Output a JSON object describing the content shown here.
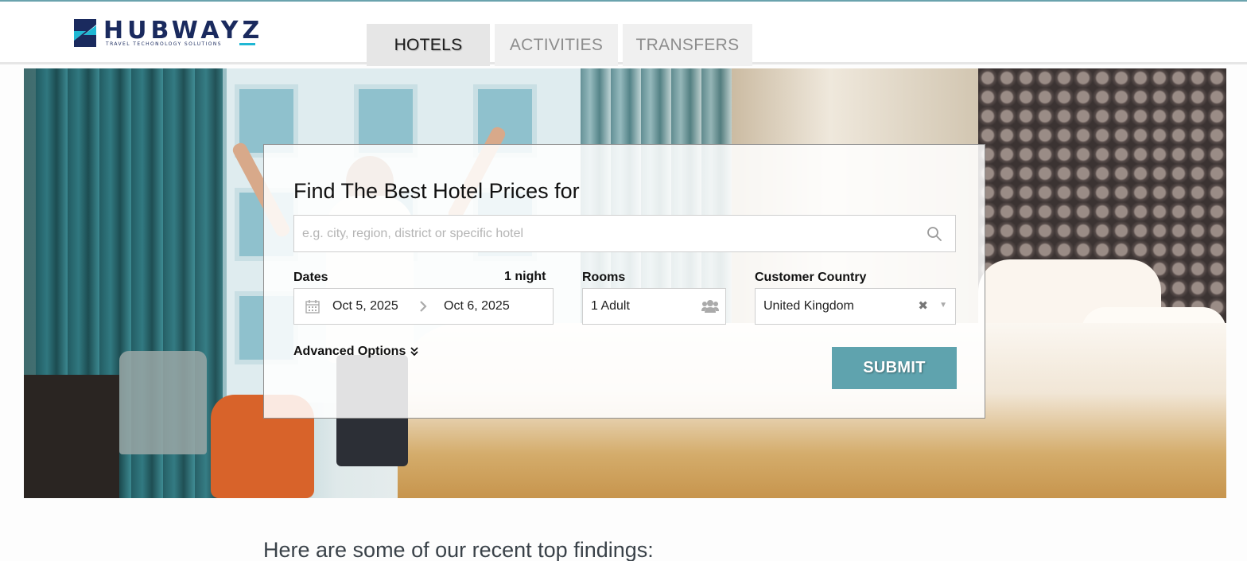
{
  "brand": {
    "name": "HUBWAYZ",
    "tagline": "TRAVEL TECHONOLOGY SOLUTIONS",
    "colors": {
      "navy": "#1a2a5e",
      "cyan": "#1fb7d4"
    }
  },
  "nav": {
    "tabs": [
      {
        "label": "HOTELS",
        "active": true
      },
      {
        "label": "ACTIVITIES",
        "active": false
      },
      {
        "label": "TRANSFERS",
        "active": false
      }
    ]
  },
  "search": {
    "title": "Find The Best Hotel Prices for",
    "destination_placeholder": "e.g. city, region, district or specific hotel",
    "destination_value": "",
    "dates": {
      "label": "Dates",
      "nights": "1 night",
      "check_in": "Oct 5, 2025",
      "check_out": "Oct 6, 2025"
    },
    "rooms": {
      "label": "Rooms",
      "value": "1 Adult"
    },
    "country": {
      "label": "Customer Country",
      "value": "United Kingdom"
    },
    "advanced_label": "Advanced Options",
    "submit_label": "SUBMIT",
    "submit_color": "#5fa3ae"
  },
  "findings_heading": "Here are some of our recent top findings:"
}
